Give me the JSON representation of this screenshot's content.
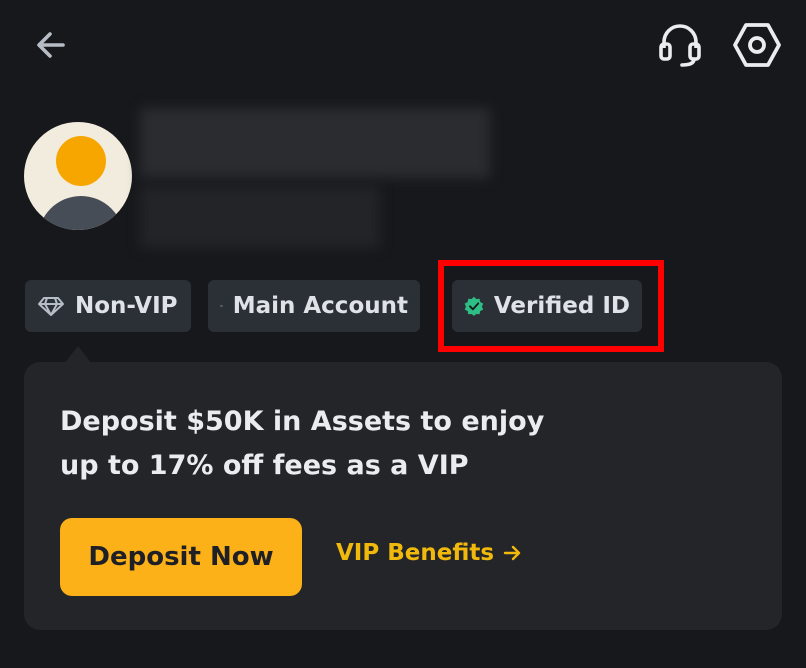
{
  "header": {
    "back_icon": "arrow-left-icon",
    "support_icon": "headset-icon",
    "settings_icon": "hexagon-settings-icon"
  },
  "profile": {
    "avatar_icon": "default-avatar"
  },
  "badges": [
    {
      "label": "Non-VIP",
      "icon": "diamond-icon"
    },
    {
      "label": "Main Account",
      "icon": "switch-account-icon"
    },
    {
      "label": "Verified ID",
      "icon": "verified-check-icon",
      "icon_color": "#2ebd85"
    }
  ],
  "promo": {
    "text_line1": "Deposit $50K in Assets to enjoy",
    "text_line2": "up to 17% off fees as a VIP",
    "deposit_label": "Deposit Now",
    "benefits_label": "VIP Benefits",
    "benefits_icon": "arrow-right-icon"
  },
  "colors": {
    "background": "#17181b",
    "card": "#232529",
    "chip": "#2b2f36",
    "accent": "#fcb118",
    "link": "#f0b90b",
    "highlight": "#ff0000"
  }
}
